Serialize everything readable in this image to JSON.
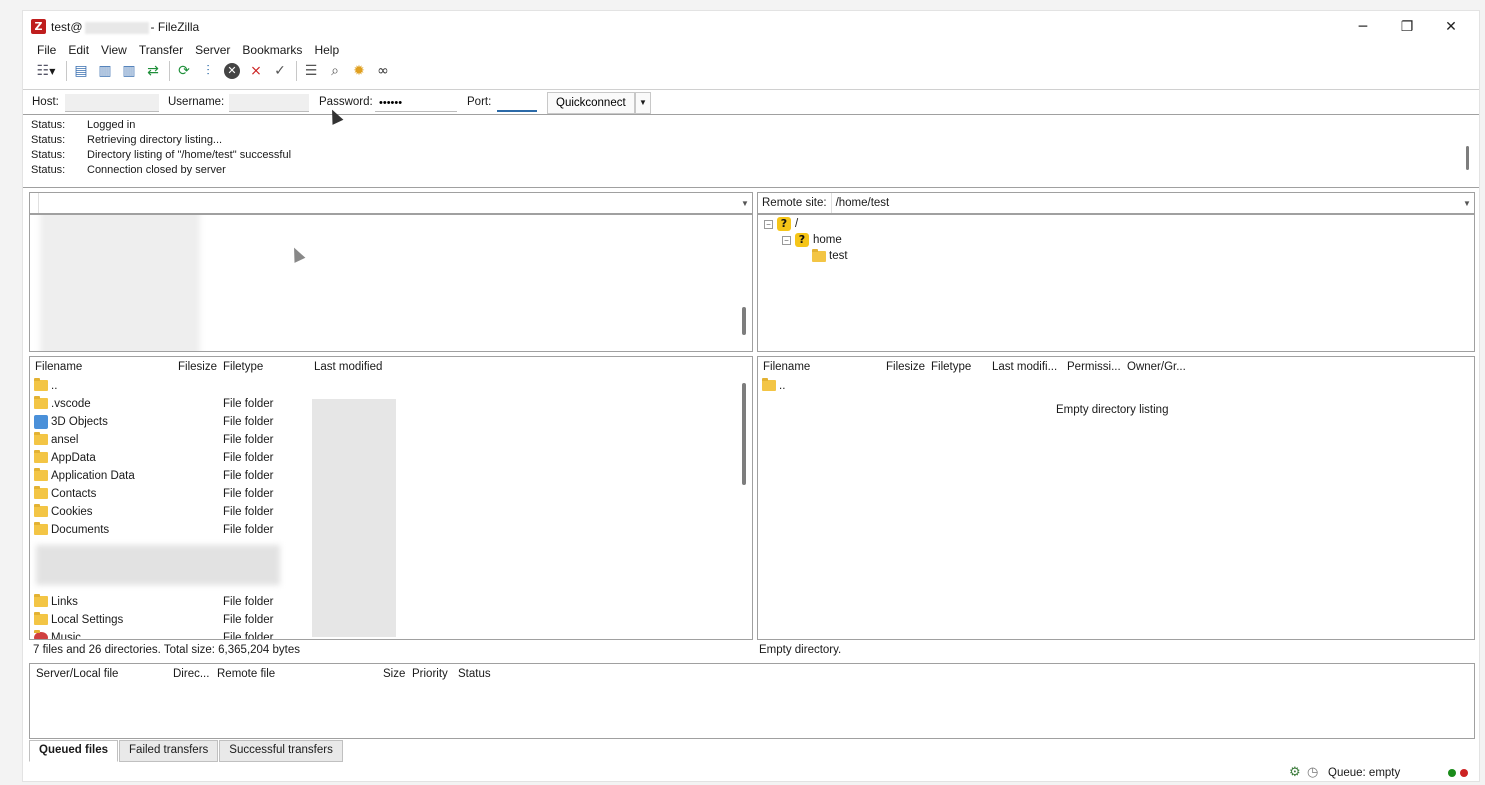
{
  "window": {
    "title_prefix": "test@",
    "title_suffix": "- FileZilla",
    "minimize": "─",
    "restore": "❐",
    "close": "✕"
  },
  "menu": [
    "File",
    "Edit",
    "View",
    "Transfer",
    "Server",
    "Bookmarks",
    "Help"
  ],
  "quickconnect": {
    "host_label": "Host:",
    "host_value": "",
    "username_label": "Username:",
    "username_value": "",
    "password_label": "Password:",
    "password_value": "••••••",
    "port_label": "Port:",
    "port_value": "",
    "button_label": "Quickconnect",
    "dropdown_icon": "▼"
  },
  "log": [
    {
      "label": "Status:",
      "text": "Logged in"
    },
    {
      "label": "Status:",
      "text": "Retrieving directory listing..."
    },
    {
      "label": "Status:",
      "text": "Directory listing of \"/home/test\" successful"
    },
    {
      "label": "Status:",
      "text": "Connection closed by server"
    }
  ],
  "local": {
    "site_label": "",
    "columns": [
      "Filename",
      "Filesize",
      "Filetype",
      "Last modified"
    ],
    "rows": [
      {
        "name": "..",
        "type": "",
        "icon": "folder-icon"
      },
      {
        "name": ".vscode",
        "type": "File folder",
        "icon": "folder-icon"
      },
      {
        "name": "3D Objects",
        "type": "File folder",
        "icon": "cube-icon"
      },
      {
        "name": "ansel",
        "type": "File folder",
        "icon": "folder-icon"
      },
      {
        "name": "AppData",
        "type": "File folder",
        "icon": "folder-icon"
      },
      {
        "name": "Application Data",
        "type": "File folder",
        "icon": "folder-icon"
      },
      {
        "name": "Contacts",
        "type": "File folder",
        "icon": "folder-icon"
      },
      {
        "name": "Cookies",
        "type": "File folder",
        "icon": "folder-icon"
      },
      {
        "name": "Documents",
        "type": "File folder",
        "icon": "folder-icon"
      },
      {
        "name": "Links",
        "type": "File folder",
        "icon": "folder-icon"
      },
      {
        "name": "Local Settings",
        "type": "File folder",
        "icon": "folder-icon"
      },
      {
        "name": "Music",
        "type": "File folder",
        "icon": "music-icon"
      }
    ],
    "summary": "7 files and 26 directories. Total size: 6,365,204 bytes"
  },
  "remote": {
    "site_label": "Remote site:",
    "site_path": "/home/test",
    "tree": [
      {
        "name": "/",
        "icon": "unknown-folder-icon",
        "toggle": "⊟"
      },
      {
        "name": "home",
        "icon": "unknown-folder-icon",
        "toggle": "⊟"
      },
      {
        "name": "test",
        "icon": "folder-icon",
        "toggle": ""
      }
    ],
    "columns": [
      "Filename",
      "Filesize",
      "Filetype",
      "Last modifi...",
      "Permissi...",
      "Owner/Gr..."
    ],
    "rows": [
      {
        "name": "..",
        "icon": "folder-icon"
      }
    ],
    "empty_message": "Empty directory listing",
    "summary": "Empty directory."
  },
  "queue": {
    "columns": [
      "Server/Local file",
      "Direc...",
      "Remote file",
      "Size",
      "Priority",
      "Status"
    ],
    "tabs": [
      "Queued files",
      "Failed transfers",
      "Successful transfers"
    ],
    "status": "Queue: empty"
  },
  "colors": {
    "accent": "#bf1e1e",
    "folder": "#f3c545",
    "unknown": "#f5c518",
    "led_green": "#1a8c1a",
    "led_red": "#cc2222"
  }
}
